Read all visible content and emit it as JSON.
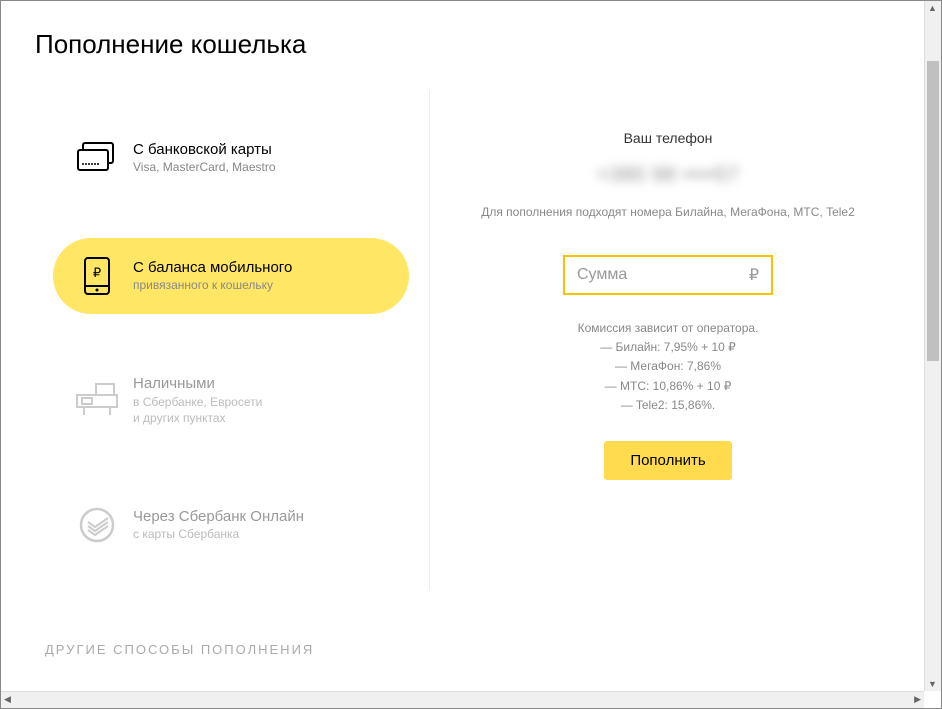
{
  "page_title": "Пополнение кошелька",
  "methods": [
    {
      "title": "С банковской карты",
      "sub": "Visa, MasterCard, Maestro",
      "active": false
    },
    {
      "title": "С баланса мобильного",
      "sub": "привязанного к кошельку",
      "active": true
    },
    {
      "title": "Наличными",
      "sub": "в Сбербанке, Евросети\nи других пунктах",
      "active": false
    },
    {
      "title": "Через Сбербанк Онлайн",
      "sub": "с карты Сбербанка",
      "active": false
    }
  ],
  "right": {
    "phone_label": "Ваш телефон",
    "phone_masked": "+380 98 ••••57",
    "phone_note": "Для пополнения подходят номера Билайна, МегаФона, МТС, Tele2",
    "amount_placeholder": "Сумма",
    "currency_symbol": "₽",
    "commission_title": "Комиссия зависит от оператора.",
    "commission_lines": [
      "— Билайн: 7,95% + 10 ₽",
      "— МегаФон: 7,86%",
      "— МТС: 10,86% + 10 ₽",
      "— Tele2: 15,86%."
    ],
    "button": "Пополнить"
  },
  "other_ways": "ДРУГИЕ СПОСОБЫ ПОПОЛНЕНИЯ"
}
